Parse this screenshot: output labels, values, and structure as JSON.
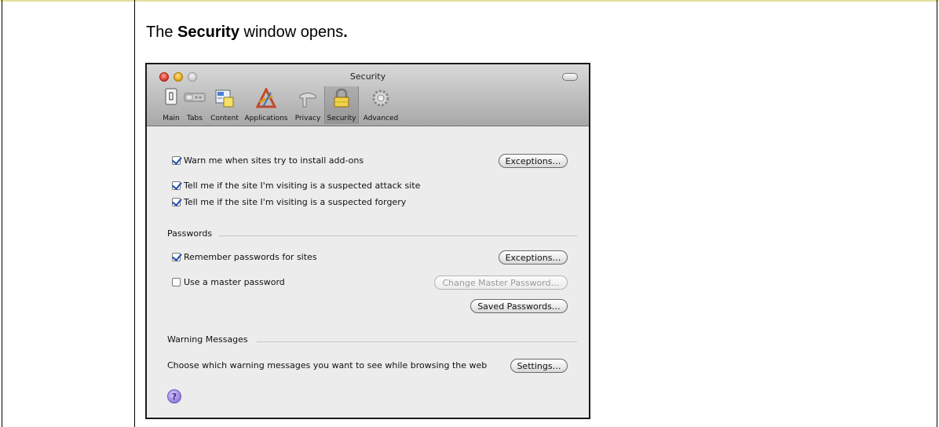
{
  "caption": {
    "prefix": "The ",
    "bold": "Security",
    "suffix": " window opens",
    "period": "."
  },
  "window": {
    "title": "Security",
    "toolbar": [
      {
        "label": "Main",
        "icon": "main-icon"
      },
      {
        "label": "Tabs",
        "icon": "tabs-icon"
      },
      {
        "label": "Content",
        "icon": "content-icon"
      },
      {
        "label": "Applications",
        "icon": "applications-icon"
      },
      {
        "label": "Privacy",
        "icon": "privacy-icon"
      },
      {
        "label": "Security",
        "icon": "lock-icon",
        "selected": true
      },
      {
        "label": "Advanced",
        "icon": "gear-icon"
      }
    ],
    "options": {
      "warn_addons": "Warn me when sites try to install add-ons",
      "attack_site": "Tell me if the site I'm visiting is a suspected attack site",
      "forgery": "Tell me if the site I'm visiting is a suspected forgery"
    },
    "exceptions_label": "Exceptions…",
    "passwords": {
      "title": "Passwords",
      "remember": "Remember passwords for sites",
      "exceptions_label": "Exceptions…",
      "master": "Use a master password",
      "change_master": "Change Master Password…",
      "saved_passwords": "Saved Passwords…"
    },
    "warning_messages": {
      "title": "Warning Messages",
      "text": "Choose which warning messages you want to see while browsing the web",
      "settings": "Settings…"
    },
    "help_label": "?"
  }
}
